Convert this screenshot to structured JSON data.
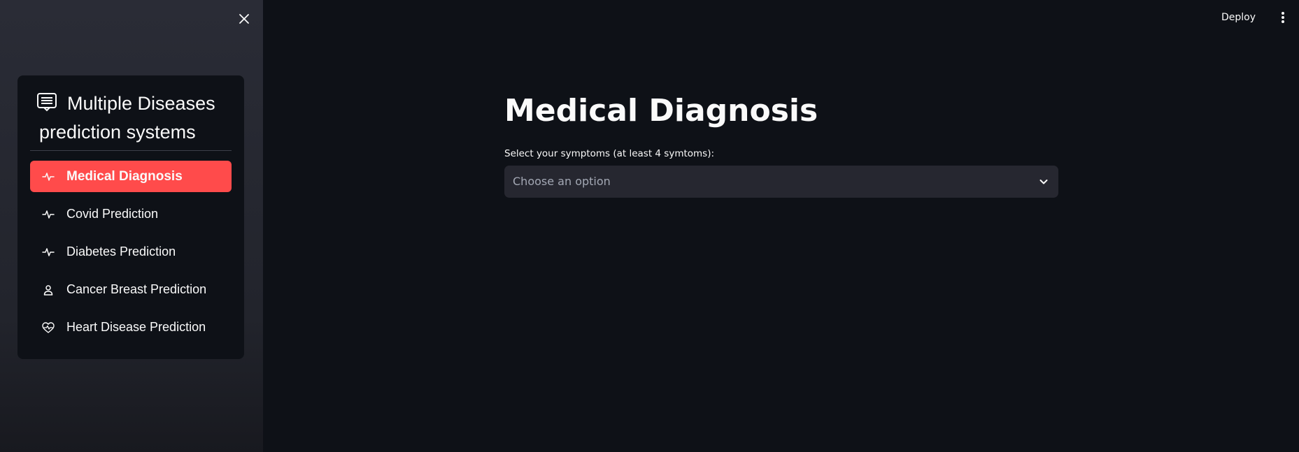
{
  "sidebar": {
    "menu_title": "Multiple Diseases prediction systems",
    "menu_title_icon": "list-card-icon",
    "close_icon": "close-icon",
    "items": [
      {
        "label": "Medical Diagnosis",
        "icon": "activity-icon",
        "active": true
      },
      {
        "label": "Covid Prediction",
        "icon": "activity-icon",
        "active": false
      },
      {
        "label": "Diabetes Prediction",
        "icon": "activity-icon",
        "active": false
      },
      {
        "label": "Cancer Breast Prediction",
        "icon": "person-icon",
        "active": false
      },
      {
        "label": "Heart Disease Prediction",
        "icon": "heart-pulse-icon",
        "active": false
      }
    ]
  },
  "header": {
    "deploy_label": "Deploy",
    "menu_icon": "kebab-menu-icon"
  },
  "main": {
    "title": "Medical Diagnosis",
    "symptoms_label": "Select your symptoms (at least 4 symtoms):",
    "symptoms_placeholder": "Choose an option"
  },
  "colors": {
    "accent": "#ff4b4b",
    "background": "#0e1117",
    "sidebar_bg": "#262730",
    "input_bg": "#262730",
    "text": "#fafafa",
    "placeholder": "#a3a8b4"
  }
}
